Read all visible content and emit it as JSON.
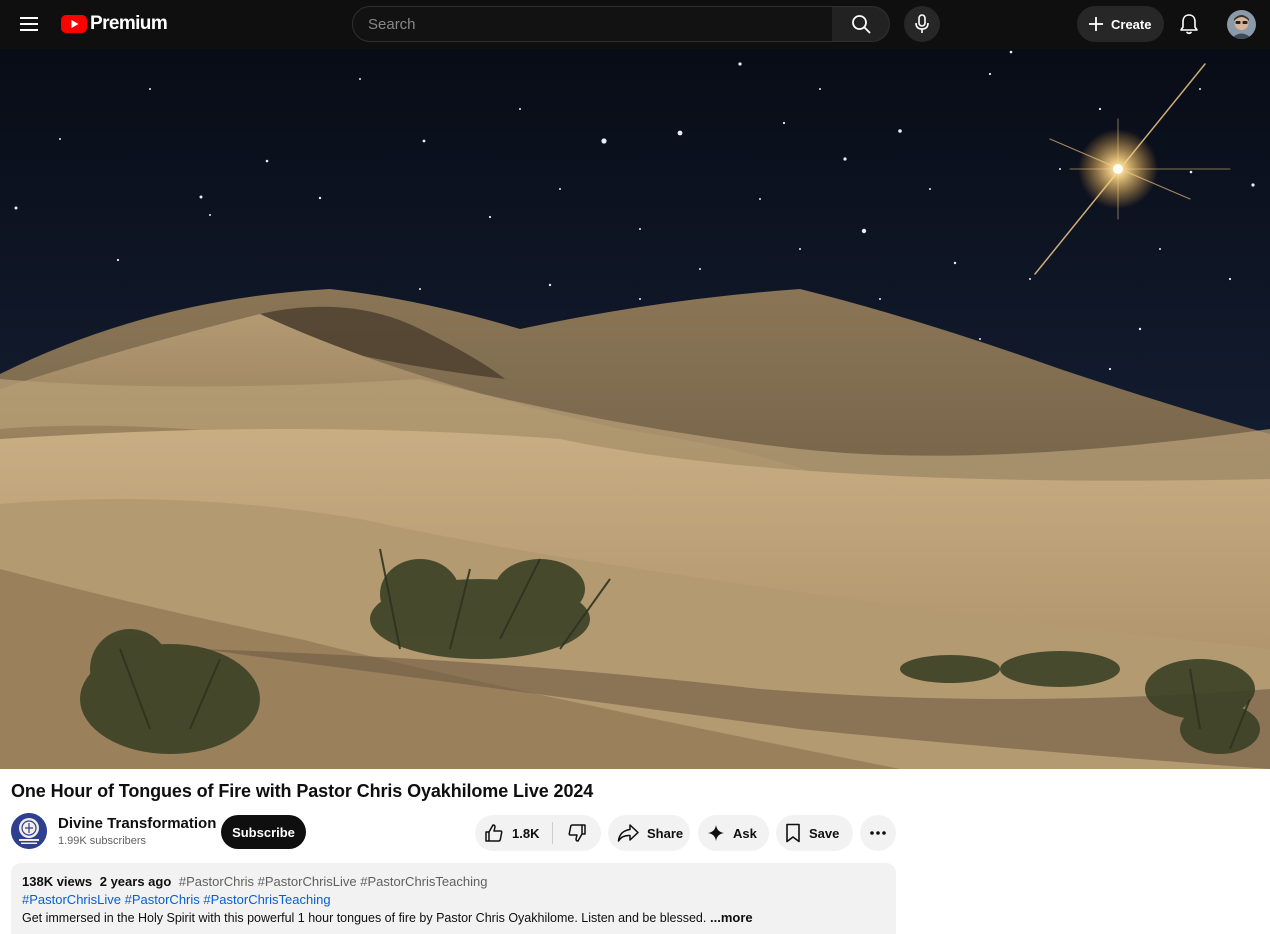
{
  "header": {
    "logo_text": "Premium",
    "search_placeholder": "Search",
    "create_label": "Create"
  },
  "video": {
    "title": "One Hour of Tongues of Fire with Pastor Chris Oyakhilome Live 2024"
  },
  "channel": {
    "name": "Divine Transformation",
    "subscribers": "1.99K subscribers",
    "subscribe_label": "Subscribe"
  },
  "actions": {
    "likes": "1.8K",
    "share_label": "Share",
    "ask_label": "Ask",
    "save_label": "Save"
  },
  "description": {
    "views": "138K views",
    "age": "2 years ago",
    "top_tags": "#PastorChris #PastorChrisLive #PastorChrisTeaching",
    "tag_links": [
      "#PastorChrisLive",
      "#PastorChris",
      "#PastorChrisTeaching"
    ],
    "text": "Get immersed in the Holy Spirit with this powerful 1 hour tongues of fire by Pastor Chris Oyakhilome. Listen and be blessed.",
    "more_label": "...more"
  },
  "colors": {
    "masthead": "#0f0f0f",
    "brand_red": "#ff0000",
    "link_blue": "#065fd4",
    "pill_bg": "#f2f2f2"
  },
  "icons": [
    "menu-icon",
    "youtube-logo-icon",
    "search-icon",
    "mic-icon",
    "plus-icon",
    "bell-icon",
    "like-icon",
    "dislike-icon",
    "share-icon",
    "sparkle-icon",
    "bookmark-icon",
    "more-horizontal-icon"
  ]
}
